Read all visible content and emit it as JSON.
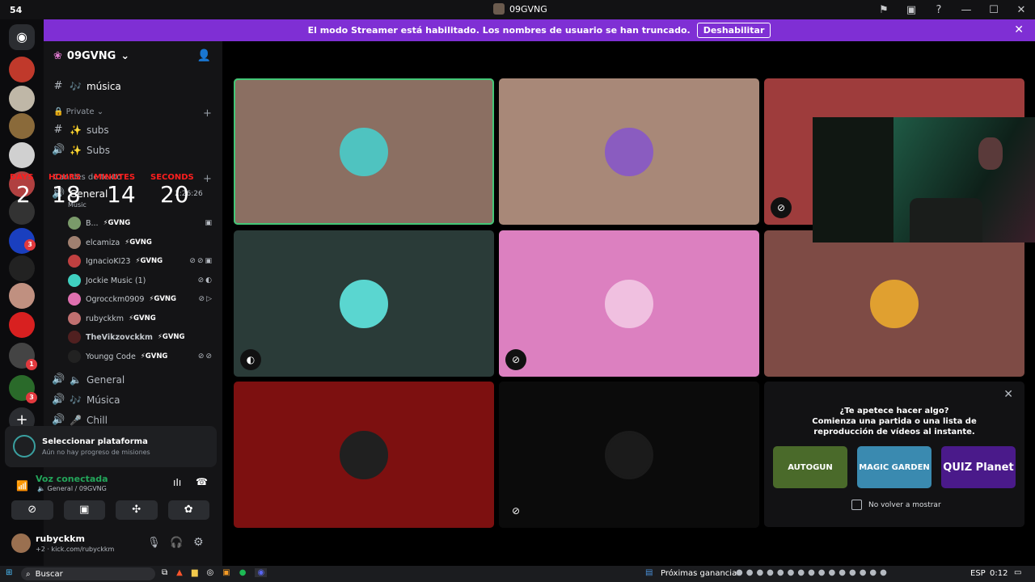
{
  "window": {
    "counter": "54",
    "title": "09GVNG"
  },
  "titlebar_icons": [
    "inbox-icon",
    "screen-share-icon",
    "help-icon",
    "minimize-icon",
    "maximize-icon",
    "close-icon"
  ],
  "banner": {
    "text": "El modo Streamer está habilitado. Los nombres de usuario se han truncado.",
    "button": "Deshabilitar"
  },
  "rail": {
    "badges": [
      "3",
      "1",
      "3"
    ]
  },
  "guild": {
    "name": "09GVNG"
  },
  "channels": {
    "musica_top": "música",
    "private_category": "Private",
    "subs_text": "subs",
    "subs_voice": "Subs",
    "voice_category": "Canales de texto",
    "general": "General",
    "general_sub": "Music",
    "general_time": "2:26:26",
    "general1": "General",
    "musica": "Música",
    "chill": "Chill"
  },
  "voice_users": [
    {
      "name": "B...",
      "tag": "⚡GVNG",
      "color": "#7a9a6a"
    },
    {
      "name": "elcamiza",
      "tag": "⚡GVNG",
      "color": "#a08070"
    },
    {
      "name": "IgnacioKI23",
      "tag": "⚡GVNG",
      "color": "#c04040"
    },
    {
      "name": "Jockie Music (1)",
      "tag": "",
      "color": "#3fd0c0"
    },
    {
      "name": "Ogrocckm0909",
      "tag": "⚡GVNG",
      "color": "#e070b0"
    },
    {
      "name": "rubyckkm",
      "tag": "⚡GVNG",
      "color": "#c07070"
    },
    {
      "name": "TheVikzovckkm",
      "tag": "⚡GVNG",
      "color": "#502020"
    },
    {
      "name": "Youngg Code",
      "tag": "⚡GVNG",
      "color": "#222222"
    }
  ],
  "countdown": {
    "labels": {
      "days": "DAYS",
      "hours": "HOURS",
      "minutes": "MINUTES",
      "seconds": "SECONDS"
    },
    "values": {
      "days": "2",
      "hours": "18",
      "minutes": "14",
      "seconds": "20"
    }
  },
  "quest": {
    "title": "Seleccionar plataforma",
    "subtitle": "Aún no hay progreso de misiones"
  },
  "voice": {
    "status": "Voz conectada",
    "channel": "General / 09GVNG"
  },
  "me": {
    "name": "rubyckkm",
    "status": "kick.com/rubyckkm",
    "extra": "+2"
  },
  "activity": {
    "title": "¿Te apetece hacer algo?",
    "subtitle": "Comienza una partida o una lista de reproducción de vídeos al instante.",
    "games": [
      "AUTOGUN",
      "MAGIC GARDEN",
      "QUIZ Planet"
    ],
    "checkbox_label": "No volver a mostrar"
  },
  "tiles": [
    {
      "bg": "#8b6f62",
      "avatar": "#4fc3c0",
      "highlight": true
    },
    {
      "bg": "#a88878",
      "avatar": "#8a5cc0",
      "highlight": false
    },
    {
      "bg": "#9e3c3c",
      "avatar": "#f0a0a0",
      "highlight": false
    },
    {
      "bg": "#2a3b38",
      "avatar": "#5ad6d0",
      "highlight": false
    },
    {
      "bg": "#dc80c0",
      "avatar": "#f0c0e0",
      "highlight": false
    },
    {
      "bg": "#7e4b45",
      "avatar": "#e0a030",
      "highlight": false
    },
    {
      "bg": "#7d1010",
      "avatar": "#202020",
      "highlight": false
    },
    {
      "bg": "#0b0b0b",
      "avatar": "#1b1b1b",
      "highlight": false
    }
  ],
  "taskbar": {
    "search": "Buscar",
    "news": "Próximas ganancias",
    "lang": "ESP",
    "time": "0:12"
  }
}
